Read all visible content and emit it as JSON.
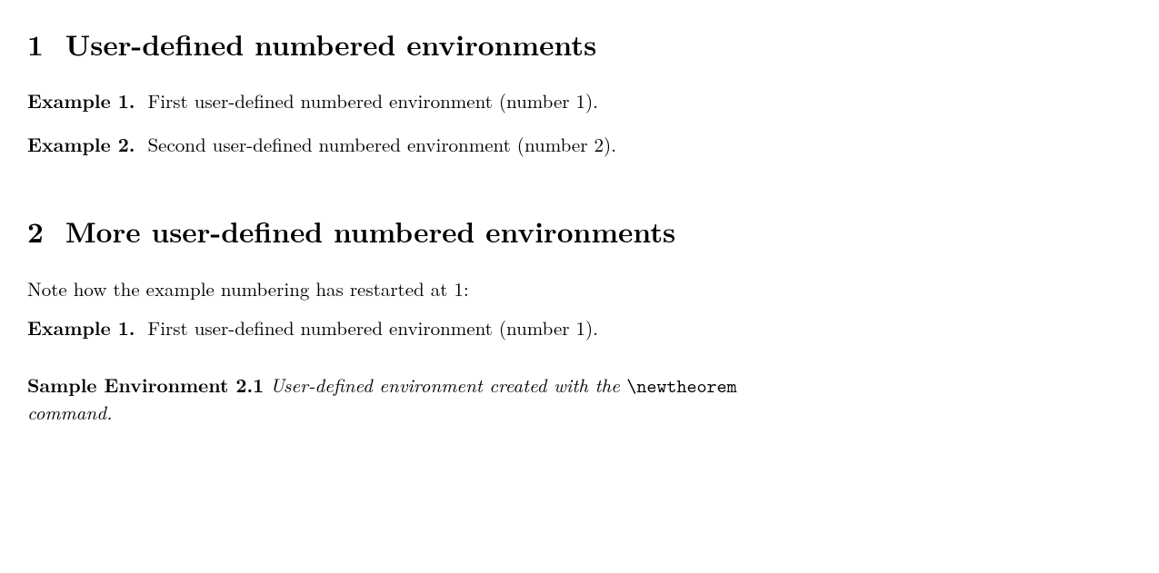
{
  "section1": {
    "number": "1",
    "title": "User-defined numbered environments",
    "examples": [
      {
        "label": "Example 1.",
        "text": "First user-defined numbered environment (number 1)."
      },
      {
        "label": "Example 2.",
        "text": "Second user-defined numbered environment (number 2)."
      }
    ]
  },
  "section2": {
    "number": "2",
    "title": "More user-defined numbered environments",
    "note": "Note how the example numbering has restarted at 1:",
    "examples": [
      {
        "label": "Example 1.",
        "text": "First user-defined numbered environment (number 1)."
      }
    ],
    "sample": {
      "label": "Sample Environment 2.1",
      "body_before": "User-defined environment created with the ",
      "command": "\\newtheorem",
      "body_after": "command."
    }
  }
}
